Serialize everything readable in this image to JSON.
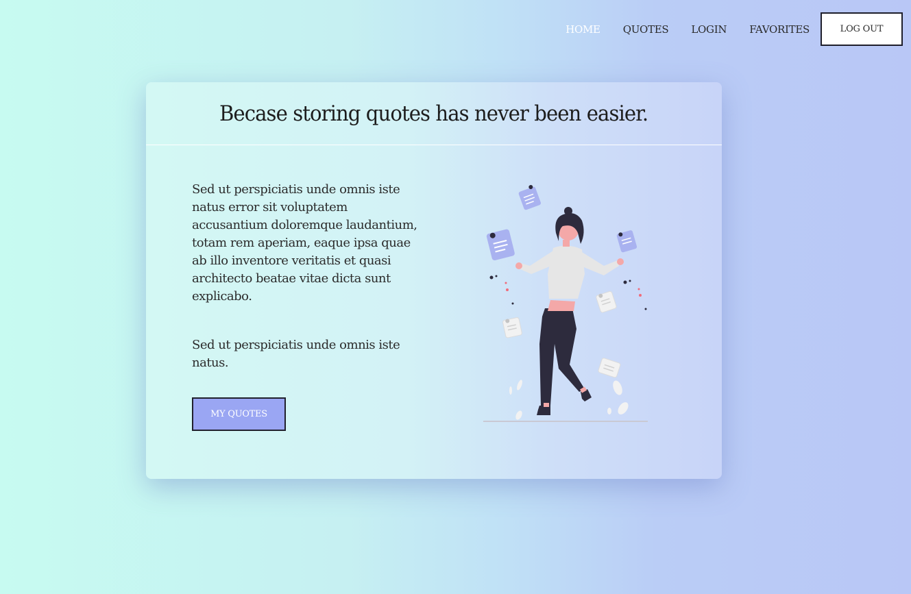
{
  "nav": {
    "items": [
      {
        "label": "HOME",
        "active": true
      },
      {
        "label": "QUOTES",
        "active": false
      },
      {
        "label": "LOGIN",
        "active": false
      },
      {
        "label": "FAVORITES",
        "active": false
      }
    ],
    "logout_label": "LOG OUT"
  },
  "card": {
    "title": "Becase storing quotes has never been easier.",
    "paragraph1": "Sed ut perspiciatis unde omnis iste natus error sit voluptatem accusantium doloremque laudantium, totam rem aperiam, eaque ipsa quae ab illo inventore veritatis et quasi architecto beatae vitae dicta sunt explicabo.",
    "paragraph2": "Sed ut perspiciatis unde omnis iste natus.",
    "cta_label": "MY QUOTES",
    "illustration": "woman-juggling-notes-illustration"
  },
  "colors": {
    "accent": "#9aa6f3",
    "dark": "#2d2b3d",
    "skin": "#f4a8a8"
  }
}
